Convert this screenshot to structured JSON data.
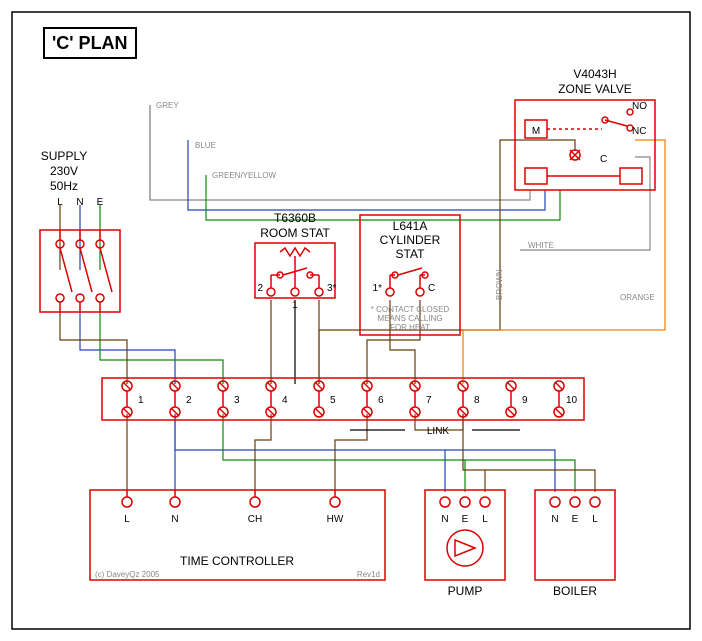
{
  "title": "'C' PLAN",
  "supply": {
    "label1": "SUPPLY",
    "label2": "230V",
    "label3": "50Hz",
    "L": "L",
    "N": "N",
    "E": "E"
  },
  "room_stat": {
    "label1": "T6360B",
    "label2": "ROOM STAT",
    "t1": "1",
    "t2": "2",
    "t3": "3*"
  },
  "cyl_stat": {
    "label1": "L641A",
    "label2": "CYLINDER",
    "label3": "STAT",
    "t1": "1*",
    "tC": "C",
    "note1": "* CONTACT CLOSED",
    "note2": "MEANS CALLING",
    "note3": "FOR HEAT"
  },
  "zone_valve": {
    "label1": "V4043H",
    "label2": "ZONE VALVE",
    "M": "M",
    "NO": "NO",
    "NC": "NC",
    "C": "C"
  },
  "junction": {
    "t": [
      "1",
      "2",
      "3",
      "4",
      "5",
      "6",
      "7",
      "8",
      "9",
      "10"
    ],
    "link": "LINK"
  },
  "time_ctrl": {
    "label": "TIME CONTROLLER",
    "L": "L",
    "N": "N",
    "CH": "CH",
    "HW": "HW",
    "copyright": "(c) DaveyQz 2005",
    "rev": "Rev1d"
  },
  "pump": {
    "label": "PUMP",
    "N": "N",
    "E": "E",
    "L": "L"
  },
  "boiler": {
    "label": "BOILER",
    "N": "N",
    "E": "E",
    "L": "L"
  },
  "wire_labels": {
    "grey": "GREY",
    "blue": "BLUE",
    "greenyellow": "GREEN/YELLOW",
    "brown": "BROWN",
    "white": "WHITE",
    "orange": "ORANGE"
  }
}
